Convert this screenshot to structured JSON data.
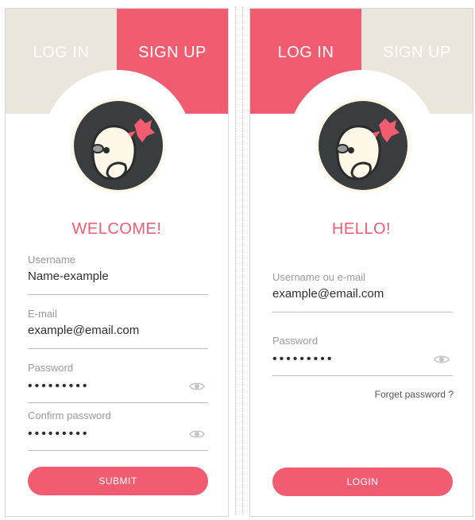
{
  "colors": {
    "accent": "#f25c71",
    "inactive_tab": "#ebe6dc"
  },
  "signup_card": {
    "tabs": {
      "login": "LOG IN",
      "signup": "SIGN UP",
      "active": "signup"
    },
    "heading": "WELCOME!",
    "fields": [
      {
        "label": "Username",
        "value": "Name-example"
      },
      {
        "label": "E-mail",
        "value": "example@email.com"
      },
      {
        "label": "Password",
        "value": "•••••••••"
      },
      {
        "label": "Confirm password",
        "value": "•••••••••"
      }
    ],
    "submit_label": "SUBMIT"
  },
  "login_card": {
    "tabs": {
      "login": "LOG IN",
      "signup": "SIGN UP",
      "active": "login"
    },
    "heading": "HELLO!",
    "fields": [
      {
        "label": "Username ou e-mail",
        "value": "example@email.com"
      },
      {
        "label": "Password",
        "value": "•••••••••"
      }
    ],
    "forgot_label": "Forget password ?",
    "login_label": "LOGIN"
  },
  "icons": {
    "avatar": "penguin-avatar-icon",
    "eye": "eye-icon"
  }
}
